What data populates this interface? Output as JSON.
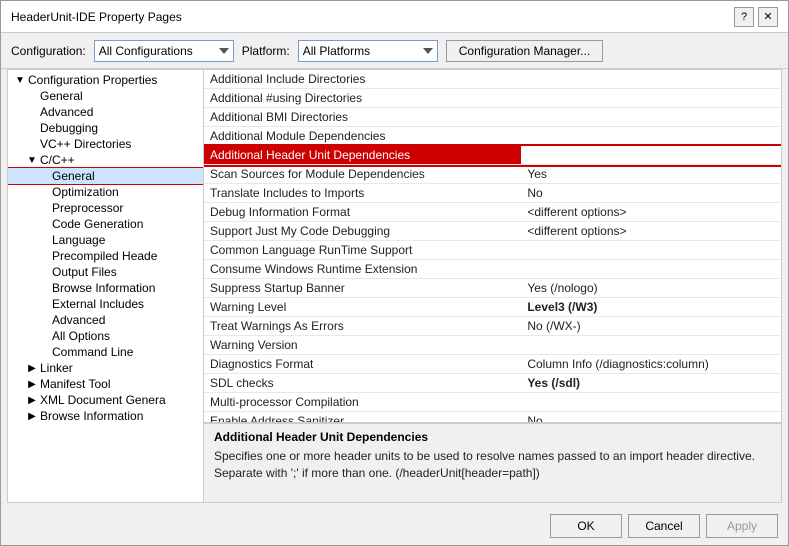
{
  "dialog": {
    "title": "HeaderUnit-IDE Property Pages",
    "close_btn": "✕",
    "help_btn": "?"
  },
  "config_bar": {
    "config_label": "Configuration:",
    "config_value": "All Configurations",
    "platform_label": "Platform:",
    "platform_value": "All Platforms",
    "manager_btn": "Configuration Manager..."
  },
  "tree": {
    "items": [
      {
        "id": "config-props",
        "label": "Configuration Properties",
        "level": 0,
        "has_expand": true,
        "expanded": true,
        "state": "expanded"
      },
      {
        "id": "general",
        "label": "General",
        "level": 1,
        "has_expand": false
      },
      {
        "id": "advanced",
        "label": "Advanced",
        "level": 1,
        "has_expand": false
      },
      {
        "id": "debugging",
        "label": "Debugging",
        "level": 1,
        "has_expand": false
      },
      {
        "id": "vcpp-dirs",
        "label": "VC++ Directories",
        "level": 1,
        "has_expand": false
      },
      {
        "id": "cpp",
        "label": "C/C++",
        "level": 1,
        "has_expand": true,
        "expanded": true
      },
      {
        "id": "cpp-general",
        "label": "General",
        "level": 2,
        "has_expand": false,
        "selected": true
      },
      {
        "id": "optimization",
        "label": "Optimization",
        "level": 2,
        "has_expand": false
      },
      {
        "id": "preprocessor",
        "label": "Preprocessor",
        "level": 2,
        "has_expand": false
      },
      {
        "id": "code-gen",
        "label": "Code Generation",
        "level": 2,
        "has_expand": false
      },
      {
        "id": "language",
        "label": "Language",
        "level": 2,
        "has_expand": false
      },
      {
        "id": "precompiled",
        "label": "Precompiled Heade",
        "level": 2,
        "has_expand": false
      },
      {
        "id": "output-files",
        "label": "Output Files",
        "level": 2,
        "has_expand": false
      },
      {
        "id": "browse-info",
        "label": "Browse Information",
        "level": 2,
        "has_expand": false
      },
      {
        "id": "external-inc",
        "label": "External Includes",
        "level": 2,
        "has_expand": false
      },
      {
        "id": "advanced2",
        "label": "Advanced",
        "level": 2,
        "has_expand": false
      },
      {
        "id": "all-options",
        "label": "All Options",
        "level": 2,
        "has_expand": false
      },
      {
        "id": "cmd-line",
        "label": "Command Line",
        "level": 2,
        "has_expand": false
      },
      {
        "id": "linker",
        "label": "Linker",
        "level": 1,
        "has_expand": true,
        "expanded": false
      },
      {
        "id": "manifest-tool",
        "label": "Manifest Tool",
        "level": 1,
        "has_expand": true,
        "expanded": false
      },
      {
        "id": "xml-doc",
        "label": "XML Document Genera",
        "level": 1,
        "has_expand": true,
        "expanded": false
      },
      {
        "id": "browse-info2",
        "label": "Browse Information",
        "level": 1,
        "has_expand": true,
        "expanded": false
      }
    ]
  },
  "properties": {
    "rows": [
      {
        "prop": "Additional Include Directories",
        "val": ""
      },
      {
        "prop": "Additional #using Directories",
        "val": ""
      },
      {
        "prop": "Additional BMI Directories",
        "val": ""
      },
      {
        "prop": "Additional Module Dependencies",
        "val": ""
      },
      {
        "prop": "Additional Header Unit Dependencies",
        "val": "",
        "highlighted": true
      },
      {
        "prop": "Scan Sources for Module Dependencies",
        "val": "Yes"
      },
      {
        "prop": "Translate Includes to Imports",
        "val": "No"
      },
      {
        "prop": "Debug Information Format",
        "val": "<different options>"
      },
      {
        "prop": "Support Just My Code Debugging",
        "val": "<different options>"
      },
      {
        "prop": "Common Language RunTime Support",
        "val": ""
      },
      {
        "prop": "Consume Windows Runtime Extension",
        "val": ""
      },
      {
        "prop": "Suppress Startup Banner",
        "val": "Yes (/nologo)"
      },
      {
        "prop": "Warning Level",
        "val": "Level3 (/W3)",
        "bold_val": true
      },
      {
        "prop": "Treat Warnings As Errors",
        "val": "No (/WX-)"
      },
      {
        "prop": "Warning Version",
        "val": ""
      },
      {
        "prop": "Diagnostics Format",
        "val": "Column Info (/diagnostics:column)"
      },
      {
        "prop": "SDL checks",
        "val": "Yes (/sdl)",
        "bold_val": true
      },
      {
        "prop": "Multi-processor Compilation",
        "val": ""
      },
      {
        "prop": "Enable Address Sanitizer",
        "val": "No"
      }
    ]
  },
  "description": {
    "title": "Additional Header Unit Dependencies",
    "text": "Specifies one or more header units to be used to resolve names passed to an import header directive.\nSeparate with ';' if more than one.  (/headerUnit[header=path])"
  },
  "footer": {
    "ok": "OK",
    "cancel": "Cancel",
    "apply": "Apply"
  }
}
